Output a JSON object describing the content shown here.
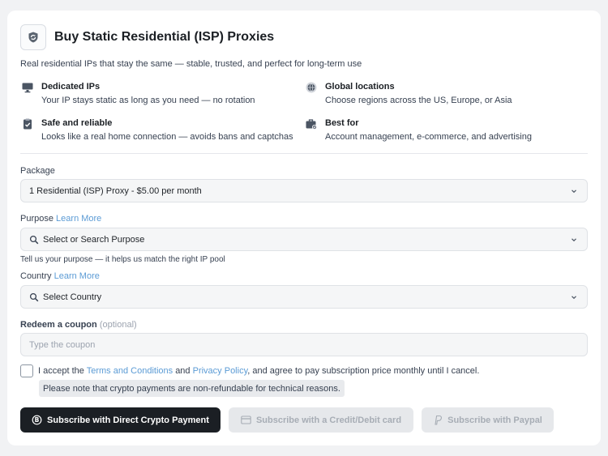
{
  "header": {
    "title": "Buy Static Residential (ISP) Proxies",
    "subtitle": "Real residential IPs that stay the same — stable, trusted, and perfect for long-term use"
  },
  "features": [
    {
      "title": "Dedicated IPs",
      "desc": "Your IP stays static as long as you need — no rotation",
      "icon": "monitor-icon"
    },
    {
      "title": "Global locations",
      "desc": "Choose regions across the US, Europe, or Asia",
      "icon": "globe-icon"
    },
    {
      "title": "Safe and reliable",
      "desc": "Looks like a real home connection — avoids bans and captchas",
      "icon": "clipboard-check-icon"
    },
    {
      "title": "Best for",
      "desc": "Account management, e-commerce, and advertising",
      "icon": "briefcase-icon"
    }
  ],
  "package": {
    "label": "Package",
    "value": "1 Residential (ISP) Proxy - $5.00 per month"
  },
  "purpose": {
    "label": "Purpose",
    "link": "Learn More",
    "value": "Select or Search Purpose",
    "hint": "Tell us your purpose — it helps us match the right IP pool"
  },
  "country": {
    "label": "Country",
    "link": "Learn More",
    "value": "Select Country"
  },
  "coupon": {
    "label": "Redeem a coupon",
    "optional": "(optional)",
    "placeholder": "Type the coupon"
  },
  "terms": {
    "prefix": "I accept the",
    "terms_link": "Terms and Conditions",
    "and": "and",
    "privacy_link": "Privacy Policy",
    "suffix": ", and agree to pay subscription price monthly until I cancel.",
    "checked": false
  },
  "note": "Please note that crypto payments are non-refundable for technical reasons.",
  "buttons": {
    "crypto": "Subscribe with Direct Crypto Payment",
    "card": "Subscribe with a Credit/Debit card",
    "paypal": "Subscribe with Paypal"
  },
  "colors": {
    "primary_button": "#1b1f24",
    "link": "#5b9bd5",
    "disabled_button": "#e6e8eb"
  }
}
